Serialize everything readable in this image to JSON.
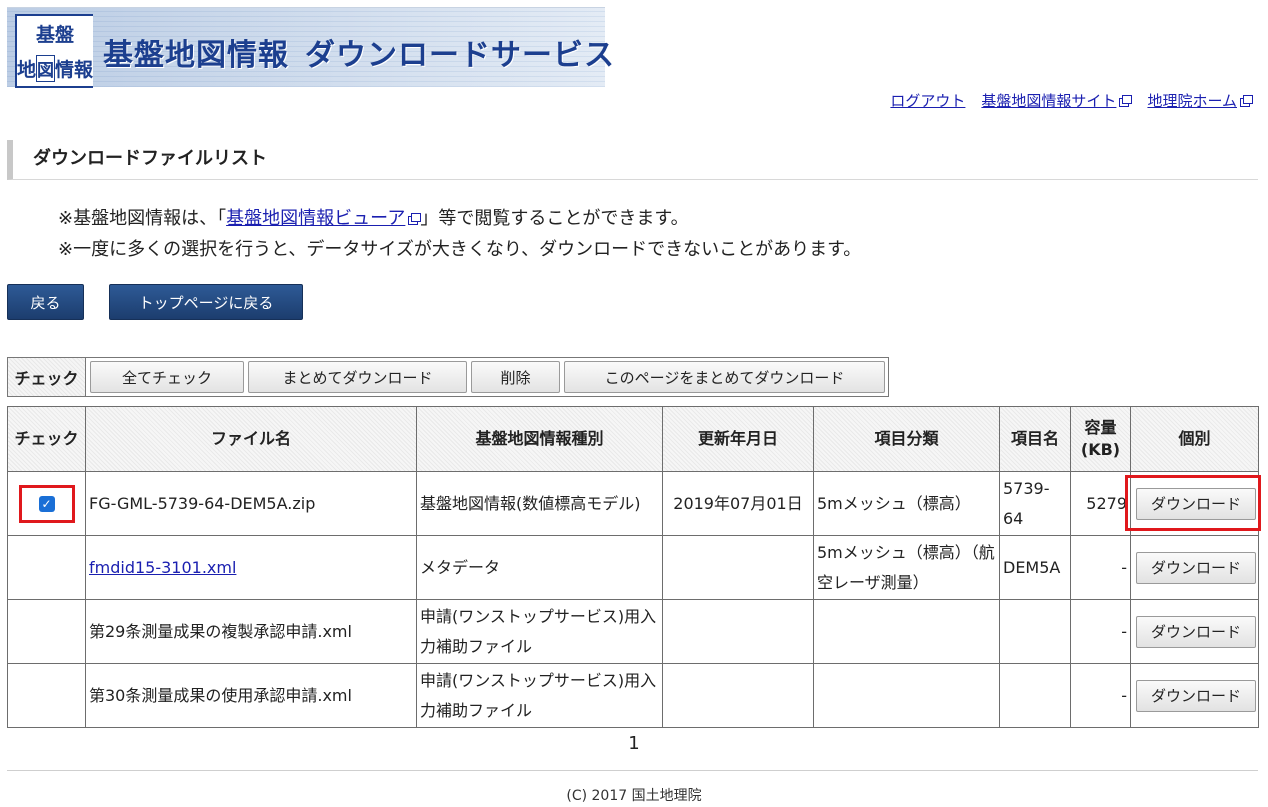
{
  "header": {
    "logo_chars": [
      "基",
      "盤",
      "地",
      "図",
      "情",
      "報"
    ],
    "title_part1": "基盤地図情報",
    "title_part2": "ダウンロードサービス"
  },
  "toplinks": {
    "logout": "ログアウト",
    "kiban_site": "基盤地図情報サイト",
    "gsi_home": "地理院ホーム"
  },
  "section_title": "ダウンロードファイルリスト",
  "notes": {
    "line1_prefix": "※基盤地図情報は、「",
    "line1_link": "基盤地図情報ビューア",
    "line1_suffix": "」等で閲覧することができます。",
    "line2": "※一度に多くの選択を行うと、データサイズが大きくなり、ダウンロードできないことがあります。"
  },
  "nav": {
    "back": "戻る",
    "top": "トップページに戻る"
  },
  "actionbar": {
    "label": "チェック",
    "check_all": "全てチェック",
    "bulk_download": "まとめてダウンロード",
    "delete": "削除",
    "page_bulk_download": "このページをまとめてダウンロード"
  },
  "table": {
    "headers": {
      "check": "チェック",
      "file": "ファイル名",
      "kind": "基盤地図情報種別",
      "date": "更新年月日",
      "category": "項目分類",
      "item": "項目名",
      "size_line1": "容量",
      "size_line2": "(KB)",
      "individual": "個別"
    },
    "rows": [
      {
        "file": "FG-GML-5739-64-DEM5A.zip",
        "kind": "基盤地図情報(数値標高モデル)",
        "date": "2019年07月01日",
        "category": "5mメッシュ（標高）",
        "item": "5739-64",
        "size": "5279",
        "button": "ダウンロード",
        "checked": true
      },
      {
        "file": "fmdid15-3101.xml",
        "kind": "メタデータ",
        "date": "",
        "category": "5mメッシュ（標高）（航空レーザ測量）",
        "item": "DEM5A",
        "size": "-",
        "button": "ダウンロード",
        "checked": false
      },
      {
        "file": "第29条測量成果の複製承認申請.xml",
        "kind": "申請(ワンストップサービス)用入力補助ファイル",
        "date": "",
        "category": "",
        "item": "",
        "size": "-",
        "button": "ダウンロード",
        "checked": false
      },
      {
        "file": "第30条測量成果の使用承認申請.xml",
        "kind": "申請(ワンストップサービス)用入力補助ファイル",
        "date": "",
        "category": "",
        "item": "",
        "size": "-",
        "button": "ダウンロード",
        "checked": false
      }
    ]
  },
  "pager": "1",
  "footer": "(C) 2017 国土地理院",
  "colors": {
    "nav_button": "#1c3d6e",
    "link": "#1a1fb0",
    "highlight": "#e0181c",
    "checkbox": "#1a6fd6"
  }
}
